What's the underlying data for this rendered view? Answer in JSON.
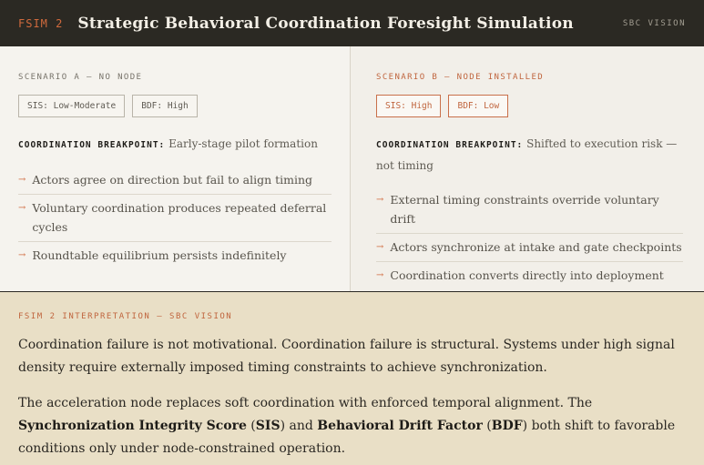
{
  "header": {
    "tag": "FSIM 2",
    "title": "Strategic Behavioral Coordination Foresight Simulation",
    "right_tag": "SBC VISION"
  },
  "scenario_a": {
    "title": "SCENARIO A — NO NODE",
    "badges": [
      "SIS: Low-Moderate",
      "BDF: High"
    ],
    "breakpoint_label": "COORDINATION BREAKPOINT:",
    "breakpoint_text": "Early-stage pilot formation",
    "items": [
      "Actors agree on direction but fail to align timing",
      "Voluntary coordination produces repeated deferral cycles",
      "Roundtable equilibrium persists indefinitely"
    ]
  },
  "scenario_b": {
    "title": "SCENARIO B — NODE INSTALLED",
    "badges": [
      "SIS: High",
      "BDF: Low"
    ],
    "breakpoint_label": "COORDINATION BREAKPOINT:",
    "breakpoint_text": "Shifted to execution risk — not timing",
    "items": [
      "External timing constraints override voluntary drift",
      "Actors synchronize at intake and gate checkpoints",
      "Coordination converts directly into deployment"
    ]
  },
  "interpretation": {
    "title": "FSIM 2 INTERPRETATION — SBC VISION",
    "para1": "Coordination failure is not motivational. Coordination failure is structural. Systems under high signal density require externally imposed timing constraints to achieve synchronization.",
    "para2_a": "The acceleration node replaces soft coordination with enforced temporal alignment. The ",
    "para2_sis_full": "Synchronization Integrity Score",
    "para2_b": " (",
    "para2_sis": "SIS",
    "para2_c": ") and ",
    "para2_bdf_full": "Behavioral Drift Factor",
    "para2_d": " (",
    "para2_bdf": "BDF",
    "para2_e": ") both shift to favorable conditions only under node-constrained operation."
  },
  "icons": {
    "bullet": "arrow-right-icon"
  },
  "colors": {
    "accent": "#d06a3d",
    "header_bg": "#2b2923",
    "interp_bg": "#e9dfc6"
  }
}
